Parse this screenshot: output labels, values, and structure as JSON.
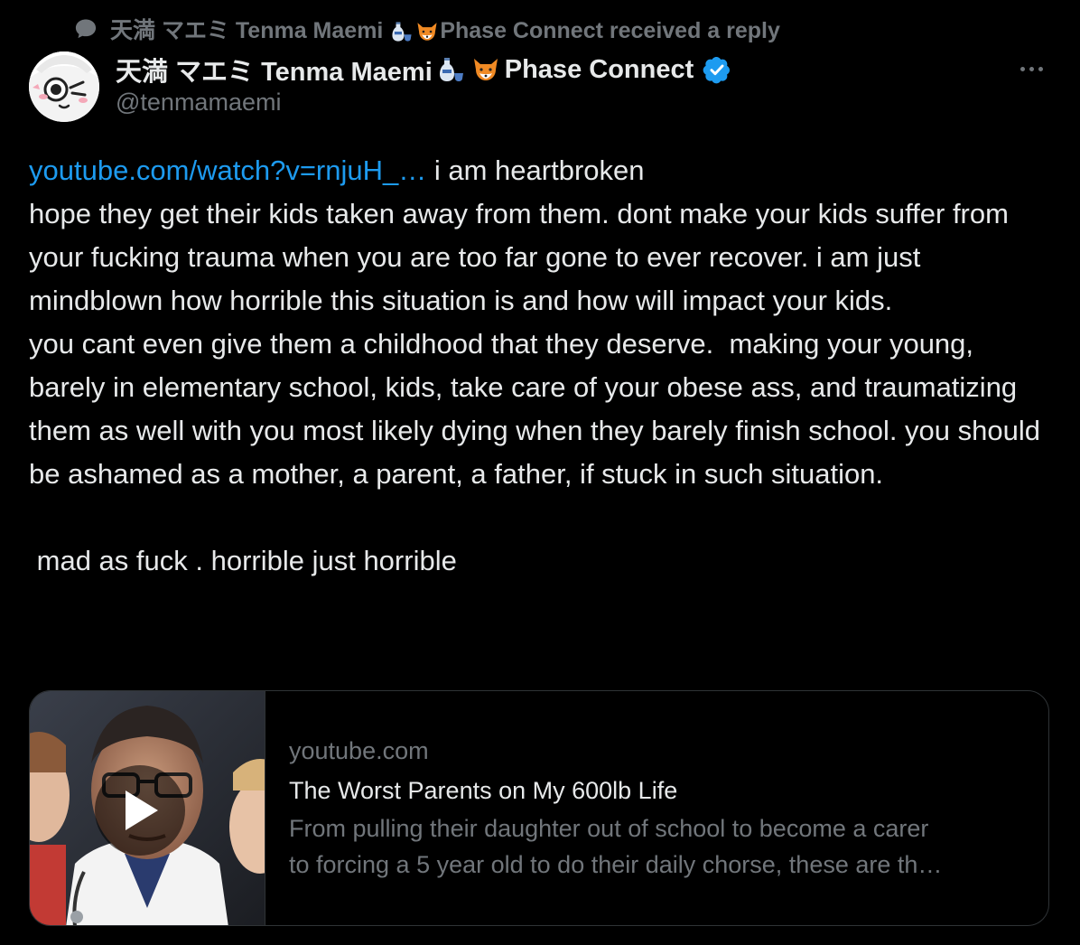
{
  "context": {
    "text_before": "天満 マエミ Tenma Maemi ",
    "text_after": "Phase Connect received a reply",
    "icon": "speech-bubble-icon"
  },
  "author": {
    "display_name": "天満 マエミ Tenma Maemi ",
    "affiliation": "Phase Connect",
    "handle": "@tenmamaemi",
    "verified": true
  },
  "tweet": {
    "link_text": "youtube.com/watch?v=rnjuH_…",
    "text_first_line": " i am heartbroken",
    "paragraph_1": "hope they get their kids taken away from them. dont make your kids suffer from your fucking trauma when you are too far gone to ever recover. i am just mindblown how horrible this situation is and how will impact your kids.",
    "paragraph_2": "you cant even give them a childhood that they deserve.  making your young, barely in elementary school, kids, take care of your obese ass, and traumatizing them as well with you most likely dying when they barely finish school. you should be ashamed as a mother, a parent, a father, if stuck in such situation.",
    "paragraph_3": " mad as fuck . horrible just horrible"
  },
  "card": {
    "domain": "youtube.com",
    "title": "The Worst Parents on My 600lb Life",
    "description_line_1": "From pulling their daughter out of school to become a carer",
    "description_line_2": "to forcing a 5 year old to do their daily chorse, these are th…"
  },
  "colors": {
    "background": "#000000",
    "text": "#e7e9ea",
    "secondary": "#71767b",
    "link": "#1d9bf0",
    "verified": "#1d9bf0",
    "border": "#2f3336"
  }
}
